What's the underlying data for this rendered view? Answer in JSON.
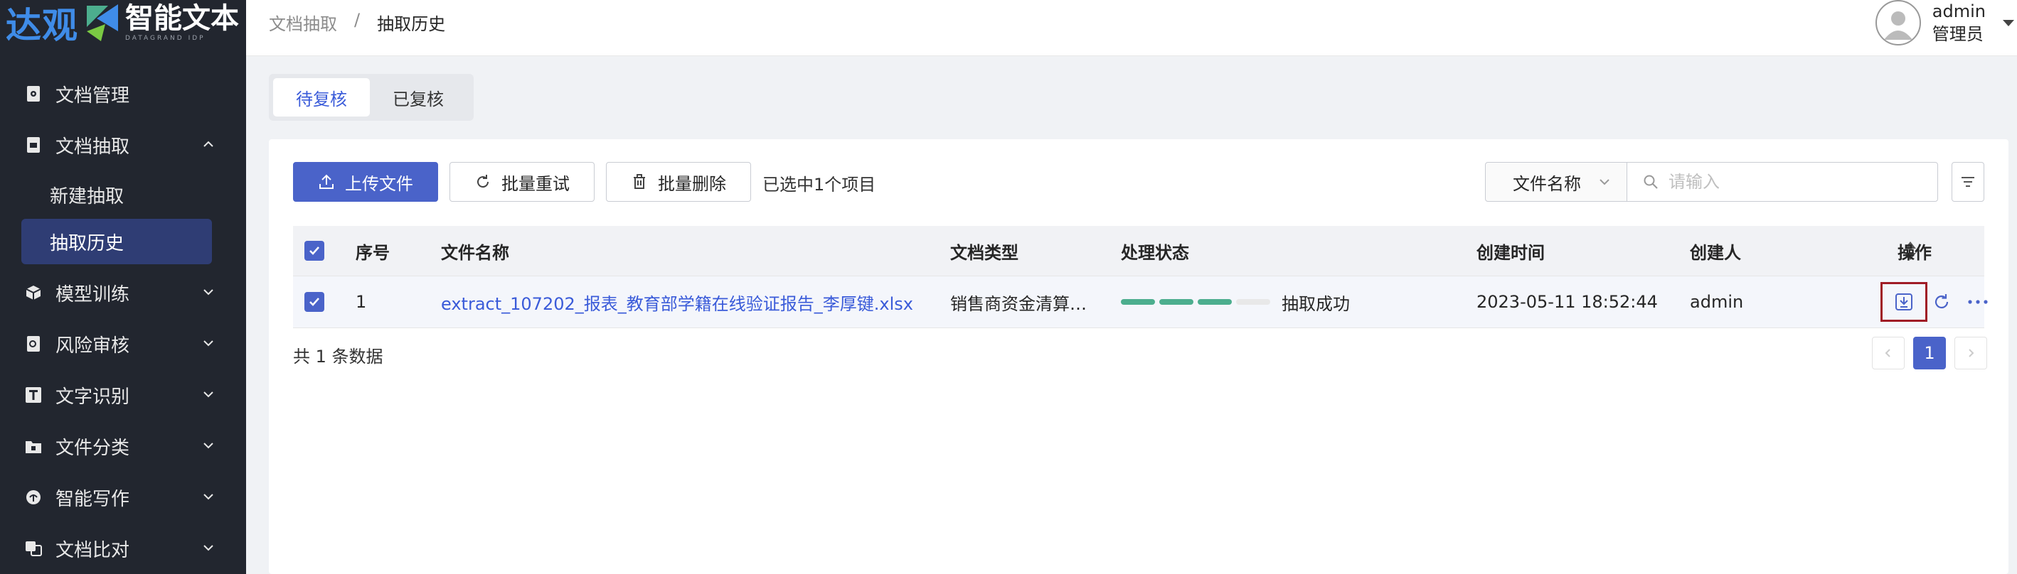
{
  "brand": {
    "name_cn": "达观",
    "product": "智能文本",
    "product_sub": "DATAGRAND IDP"
  },
  "breadcrumb": {
    "parent": "文档抽取",
    "separator": "/",
    "current": "抽取历史"
  },
  "user": {
    "name": "admin",
    "role": "管理员"
  },
  "sidebar": {
    "items": [
      {
        "label": "文档管理"
      },
      {
        "label": "文档抽取"
      },
      {
        "label": "新建抽取"
      },
      {
        "label": "抽取历史"
      },
      {
        "label": "模型训练"
      },
      {
        "label": "风险审核"
      },
      {
        "label": "文字识别"
      },
      {
        "label": "文件分类"
      },
      {
        "label": "智能写作"
      },
      {
        "label": "文档比对"
      }
    ]
  },
  "tabs": [
    {
      "label": "待复核"
    },
    {
      "label": "已复核"
    }
  ],
  "toolbar": {
    "upload": "上传文件",
    "retry": "批量重试",
    "delete": "批量删除",
    "selected_info": "已选中1个项目",
    "search_field": "文件名称",
    "search_placeholder": "请输入"
  },
  "table": {
    "headers": {
      "index": "序号",
      "filename": "文件名称",
      "doc_type": "文档类型",
      "status": "处理状态",
      "created_at": "创建时间",
      "creator": "创建人",
      "actions": "操作"
    },
    "rows": [
      {
        "index": "1",
        "filename": "extract_107202_报表_教育部学籍在线验证报告_李厚键.xlsx",
        "doc_type": "销售商资金清算…",
        "status": "抽取成功",
        "progress_segments_filled": 3,
        "progress_segments_total": 4,
        "created_at": "2023-05-11 18:52:44",
        "creator": "admin",
        "selected": true
      }
    ]
  },
  "footer": {
    "total": "共 1 条数据",
    "current_page": "1"
  },
  "colors": {
    "primary": "#4a63c9",
    "sidebar_bg": "#22262f",
    "progress": "#4cae8e",
    "highlight_box": "#a01c26"
  }
}
